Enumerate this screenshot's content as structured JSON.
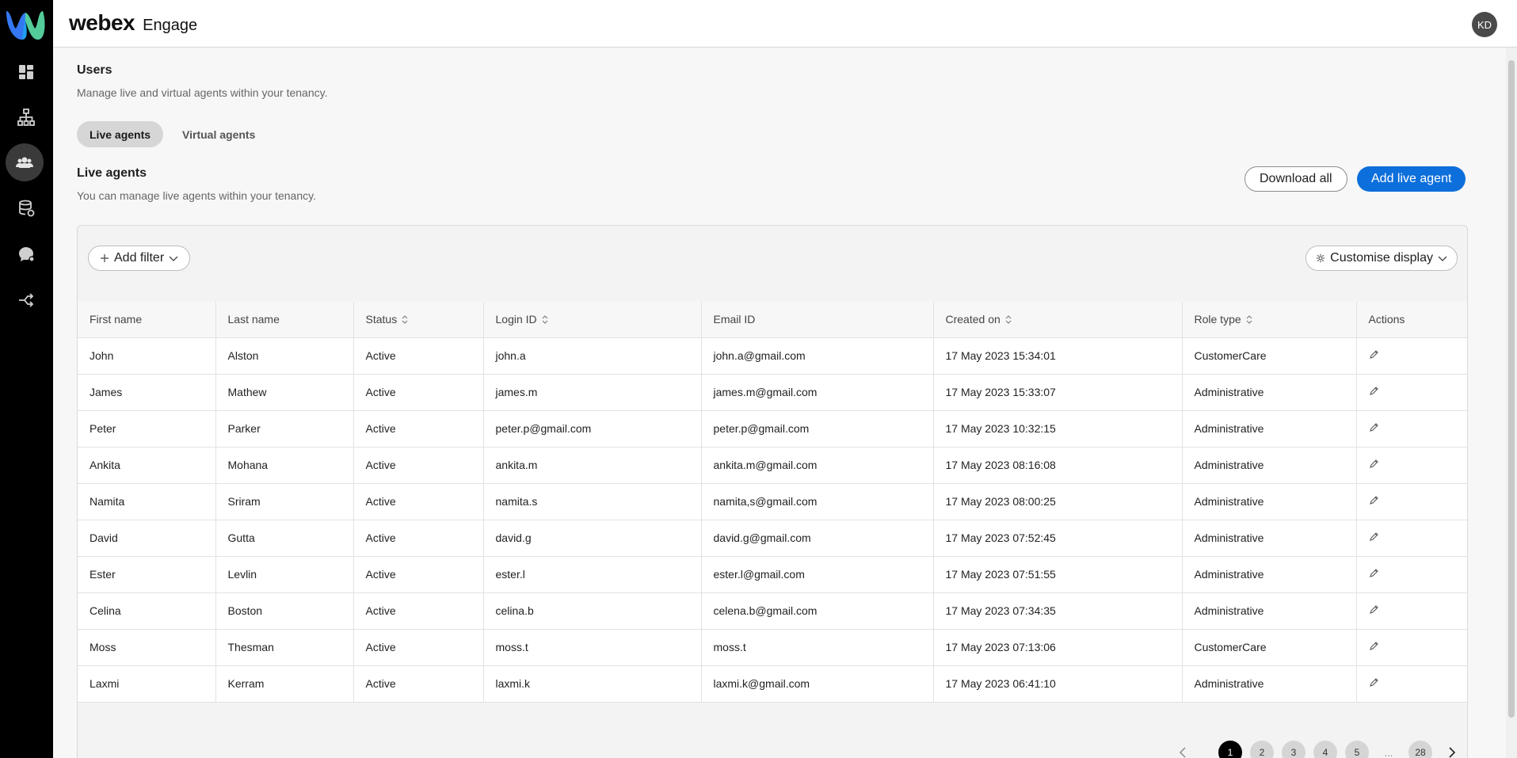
{
  "brand": {
    "name": "webex",
    "product": "Engage"
  },
  "user": {
    "initials": "KD"
  },
  "rail": {
    "items": [
      {
        "icon": "dashboard-icon"
      },
      {
        "icon": "org-chart-icon"
      },
      {
        "icon": "users-icon",
        "active": true
      },
      {
        "icon": "database-icon"
      },
      {
        "icon": "chat-bubble-icon"
      },
      {
        "icon": "routing-icon"
      }
    ]
  },
  "page": {
    "title": "Users",
    "subtitle": "Manage live and virtual agents within your tenancy.",
    "tabs": [
      {
        "label": "Live agents",
        "active": true
      },
      {
        "label": "Virtual agents",
        "active": false
      }
    ]
  },
  "section": {
    "title": "Live agents",
    "subtitle": "You can manage live agents within your tenancy.",
    "download_label": "Download all",
    "add_label": "Add live agent"
  },
  "toolbar": {
    "filter_label": "Add filter",
    "customise_label": "Customise display"
  },
  "table": {
    "columns": [
      {
        "label": "First name",
        "sortable": false
      },
      {
        "label": "Last name",
        "sortable": false
      },
      {
        "label": "Status",
        "sortable": true
      },
      {
        "label": "Login ID",
        "sortable": true
      },
      {
        "label": "Email ID",
        "sortable": false
      },
      {
        "label": "Created on",
        "sortable": true
      },
      {
        "label": "Role type",
        "sortable": true
      },
      {
        "label": "Actions",
        "sortable": false
      }
    ],
    "rows": [
      [
        "John",
        "Alston",
        "Active",
        "john.a",
        "john.a@gmail.com",
        "17 May 2023 15:34:01",
        "CustomerCare"
      ],
      [
        "James",
        "Mathew",
        "Active",
        "james.m",
        "james.m@gmail.com",
        "17 May 2023 15:33:07",
        "Administrative"
      ],
      [
        "Peter",
        "Parker",
        "Active",
        "peter.p@gmail.com",
        "peter.p@gmail.com",
        "17 May 2023 10:32:15",
        "Administrative"
      ],
      [
        "Ankita",
        "Mohana",
        "Active",
        "ankita.m",
        "ankita.m@gmail.com",
        "17 May 2023 08:16:08",
        "Administrative"
      ],
      [
        "Namita",
        "Sriram",
        "Active",
        "namita.s",
        "namita,s@gmail.com",
        "17 May 2023 08:00:25",
        "Administrative"
      ],
      [
        "David",
        "Gutta",
        "Active",
        "david.g",
        "david.g@gmail.com",
        "17 May 2023 07:52:45",
        "Administrative"
      ],
      [
        "Ester",
        "Levlin",
        "Active",
        "ester.l",
        "ester.l@gmail.com",
        "17 May 2023 07:51:55",
        "Administrative"
      ],
      [
        "Celina",
        "Boston",
        "Active",
        "celina.b",
        "celena.b@gmail.com",
        "17 May 2023 07:34:35",
        "Administrative"
      ],
      [
        "Moss",
        "Thesman",
        "Active",
        "moss.t",
        "moss.t",
        "17 May 2023 07:13:06",
        "CustomerCare"
      ],
      [
        "Laxmi",
        "Kerram",
        "Active",
        "laxmi.k",
        "laxmi.k@gmail.com",
        "17 May 2023 06:41:10",
        "Administrative"
      ]
    ]
  },
  "pagination": {
    "pages": [
      "1",
      "2",
      "3",
      "4",
      "5"
    ],
    "current": "1",
    "ellipsis": "...",
    "last": "28"
  }
}
